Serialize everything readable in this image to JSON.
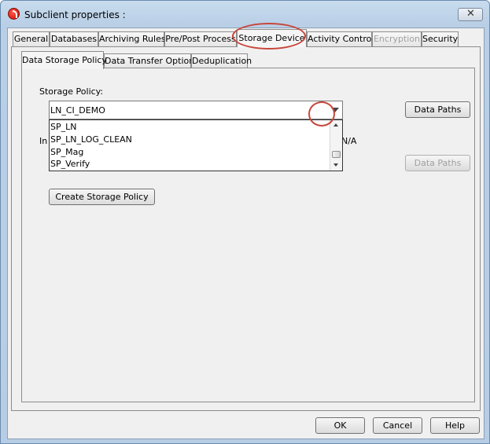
{
  "window": {
    "title": "Subclient properties :"
  },
  "tabs": [
    {
      "label": "General"
    },
    {
      "label": "Databases"
    },
    {
      "label": "Archiving Rules"
    },
    {
      "label": "Pre/Post Process"
    },
    {
      "label": "Storage Device"
    },
    {
      "label": "Activity Control"
    },
    {
      "label": "Encryption"
    },
    {
      "label": "Security"
    }
  ],
  "active_tab": "Storage Device",
  "subtabs": [
    {
      "label": "Data Storage Policy"
    },
    {
      "label": "Data Transfer Option"
    },
    {
      "label": "Deduplication"
    }
  ],
  "storage": {
    "policy_label": "Storage Policy:",
    "selected_policy": "LN_CI_DEMO",
    "dropdown_options": [
      "SP_LN",
      "SP_LN_LOG_CLEAN",
      "SP_Mag",
      "SP_Verify"
    ],
    "hidden_label_prefix": "In",
    "hidden_label_suffix": "N/A",
    "data_paths_label": "Data Paths",
    "data_paths_2_label": "Data Paths",
    "create_policy_label": "Create Storage Policy"
  },
  "footer": {
    "ok": "OK",
    "cancel": "Cancel",
    "help": "Help"
  },
  "colors": {
    "highlight_ring": "#c8463b"
  }
}
